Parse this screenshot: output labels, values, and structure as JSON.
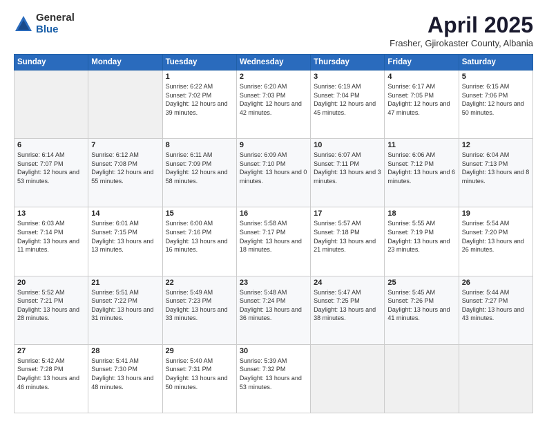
{
  "logo": {
    "general": "General",
    "blue": "Blue"
  },
  "header": {
    "month": "April 2025",
    "location": "Frasher, Gjirokaster County, Albania"
  },
  "weekdays": [
    "Sunday",
    "Monday",
    "Tuesday",
    "Wednesday",
    "Thursday",
    "Friday",
    "Saturday"
  ],
  "weeks": [
    [
      {
        "day": "",
        "sunrise": "",
        "sunset": "",
        "daylight": ""
      },
      {
        "day": "",
        "sunrise": "",
        "sunset": "",
        "daylight": ""
      },
      {
        "day": "1",
        "sunrise": "Sunrise: 6:22 AM",
        "sunset": "Sunset: 7:02 PM",
        "daylight": "Daylight: 12 hours and 39 minutes."
      },
      {
        "day": "2",
        "sunrise": "Sunrise: 6:20 AM",
        "sunset": "Sunset: 7:03 PM",
        "daylight": "Daylight: 12 hours and 42 minutes."
      },
      {
        "day": "3",
        "sunrise": "Sunrise: 6:19 AM",
        "sunset": "Sunset: 7:04 PM",
        "daylight": "Daylight: 12 hours and 45 minutes."
      },
      {
        "day": "4",
        "sunrise": "Sunrise: 6:17 AM",
        "sunset": "Sunset: 7:05 PM",
        "daylight": "Daylight: 12 hours and 47 minutes."
      },
      {
        "day": "5",
        "sunrise": "Sunrise: 6:15 AM",
        "sunset": "Sunset: 7:06 PM",
        "daylight": "Daylight: 12 hours and 50 minutes."
      }
    ],
    [
      {
        "day": "6",
        "sunrise": "Sunrise: 6:14 AM",
        "sunset": "Sunset: 7:07 PM",
        "daylight": "Daylight: 12 hours and 53 minutes."
      },
      {
        "day": "7",
        "sunrise": "Sunrise: 6:12 AM",
        "sunset": "Sunset: 7:08 PM",
        "daylight": "Daylight: 12 hours and 55 minutes."
      },
      {
        "day": "8",
        "sunrise": "Sunrise: 6:11 AM",
        "sunset": "Sunset: 7:09 PM",
        "daylight": "Daylight: 12 hours and 58 minutes."
      },
      {
        "day": "9",
        "sunrise": "Sunrise: 6:09 AM",
        "sunset": "Sunset: 7:10 PM",
        "daylight": "Daylight: 13 hours and 0 minutes."
      },
      {
        "day": "10",
        "sunrise": "Sunrise: 6:07 AM",
        "sunset": "Sunset: 7:11 PM",
        "daylight": "Daylight: 13 hours and 3 minutes."
      },
      {
        "day": "11",
        "sunrise": "Sunrise: 6:06 AM",
        "sunset": "Sunset: 7:12 PM",
        "daylight": "Daylight: 13 hours and 6 minutes."
      },
      {
        "day": "12",
        "sunrise": "Sunrise: 6:04 AM",
        "sunset": "Sunset: 7:13 PM",
        "daylight": "Daylight: 13 hours and 8 minutes."
      }
    ],
    [
      {
        "day": "13",
        "sunrise": "Sunrise: 6:03 AM",
        "sunset": "Sunset: 7:14 PM",
        "daylight": "Daylight: 13 hours and 11 minutes."
      },
      {
        "day": "14",
        "sunrise": "Sunrise: 6:01 AM",
        "sunset": "Sunset: 7:15 PM",
        "daylight": "Daylight: 13 hours and 13 minutes."
      },
      {
        "day": "15",
        "sunrise": "Sunrise: 6:00 AM",
        "sunset": "Sunset: 7:16 PM",
        "daylight": "Daylight: 13 hours and 16 minutes."
      },
      {
        "day": "16",
        "sunrise": "Sunrise: 5:58 AM",
        "sunset": "Sunset: 7:17 PM",
        "daylight": "Daylight: 13 hours and 18 minutes."
      },
      {
        "day": "17",
        "sunrise": "Sunrise: 5:57 AM",
        "sunset": "Sunset: 7:18 PM",
        "daylight": "Daylight: 13 hours and 21 minutes."
      },
      {
        "day": "18",
        "sunrise": "Sunrise: 5:55 AM",
        "sunset": "Sunset: 7:19 PM",
        "daylight": "Daylight: 13 hours and 23 minutes."
      },
      {
        "day": "19",
        "sunrise": "Sunrise: 5:54 AM",
        "sunset": "Sunset: 7:20 PM",
        "daylight": "Daylight: 13 hours and 26 minutes."
      }
    ],
    [
      {
        "day": "20",
        "sunrise": "Sunrise: 5:52 AM",
        "sunset": "Sunset: 7:21 PM",
        "daylight": "Daylight: 13 hours and 28 minutes."
      },
      {
        "day": "21",
        "sunrise": "Sunrise: 5:51 AM",
        "sunset": "Sunset: 7:22 PM",
        "daylight": "Daylight: 13 hours and 31 minutes."
      },
      {
        "day": "22",
        "sunrise": "Sunrise: 5:49 AM",
        "sunset": "Sunset: 7:23 PM",
        "daylight": "Daylight: 13 hours and 33 minutes."
      },
      {
        "day": "23",
        "sunrise": "Sunrise: 5:48 AM",
        "sunset": "Sunset: 7:24 PM",
        "daylight": "Daylight: 13 hours and 36 minutes."
      },
      {
        "day": "24",
        "sunrise": "Sunrise: 5:47 AM",
        "sunset": "Sunset: 7:25 PM",
        "daylight": "Daylight: 13 hours and 38 minutes."
      },
      {
        "day": "25",
        "sunrise": "Sunrise: 5:45 AM",
        "sunset": "Sunset: 7:26 PM",
        "daylight": "Daylight: 13 hours and 41 minutes."
      },
      {
        "day": "26",
        "sunrise": "Sunrise: 5:44 AM",
        "sunset": "Sunset: 7:27 PM",
        "daylight": "Daylight: 13 hours and 43 minutes."
      }
    ],
    [
      {
        "day": "27",
        "sunrise": "Sunrise: 5:42 AM",
        "sunset": "Sunset: 7:28 PM",
        "daylight": "Daylight: 13 hours and 46 minutes."
      },
      {
        "day": "28",
        "sunrise": "Sunrise: 5:41 AM",
        "sunset": "Sunset: 7:30 PM",
        "daylight": "Daylight: 13 hours and 48 minutes."
      },
      {
        "day": "29",
        "sunrise": "Sunrise: 5:40 AM",
        "sunset": "Sunset: 7:31 PM",
        "daylight": "Daylight: 13 hours and 50 minutes."
      },
      {
        "day": "30",
        "sunrise": "Sunrise: 5:39 AM",
        "sunset": "Sunset: 7:32 PM",
        "daylight": "Daylight: 13 hours and 53 minutes."
      },
      {
        "day": "",
        "sunrise": "",
        "sunset": "",
        "daylight": ""
      },
      {
        "day": "",
        "sunrise": "",
        "sunset": "",
        "daylight": ""
      },
      {
        "day": "",
        "sunrise": "",
        "sunset": "",
        "daylight": ""
      }
    ]
  ]
}
